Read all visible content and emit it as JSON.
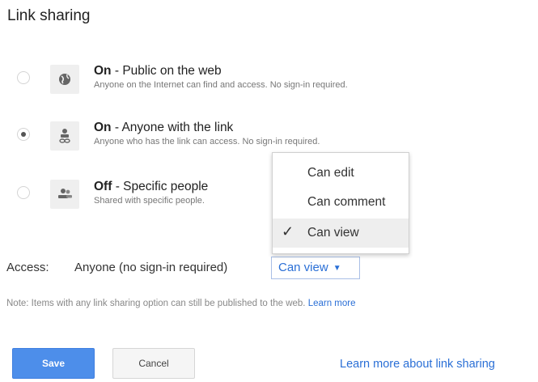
{
  "title": "Link sharing",
  "options": [
    {
      "status": "On",
      "title_rest": "Public on the web",
      "desc": "Anyone on the Internet can find and access. No sign-in required.",
      "icon": "globe-icon",
      "checked": false
    },
    {
      "status": "On",
      "title_rest": "Anyone with the link",
      "desc": "Anyone who has the link can access. No sign-in required.",
      "icon": "link-person-icon",
      "checked": true
    },
    {
      "status": "Off",
      "title_rest": "Specific people",
      "desc": "Shared with specific people.",
      "icon": "people-icon",
      "checked": false
    }
  ],
  "separator": " - ",
  "access": {
    "label": "Access:",
    "value": "Anyone (no sign-in required)",
    "dropdown_value": "Can view",
    "caret": "▼"
  },
  "menu": {
    "items": [
      "Can edit",
      "Can comment",
      "Can view"
    ],
    "selected_index": 2,
    "check": "✓"
  },
  "note": {
    "text": "Note: Items with any link sharing option can still be published to the web.",
    "link": "Learn more"
  },
  "buttons": {
    "save": "Save",
    "cancel": "Cancel"
  },
  "learn_more_link": "Learn more about link sharing",
  "colors": {
    "accent": "#4d8eea",
    "link": "#2a6fd6"
  }
}
